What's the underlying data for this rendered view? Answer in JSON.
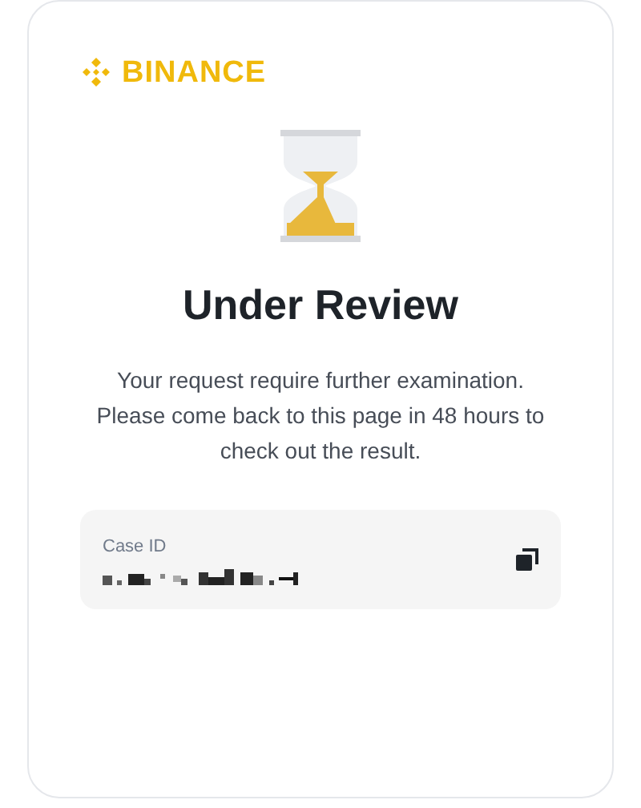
{
  "logo": {
    "text": "BINANCE"
  },
  "title": "Under Review",
  "message": "Your request require further examination. Please come back to this page in 48 hours to check out the result.",
  "case": {
    "label": "Case ID"
  }
}
